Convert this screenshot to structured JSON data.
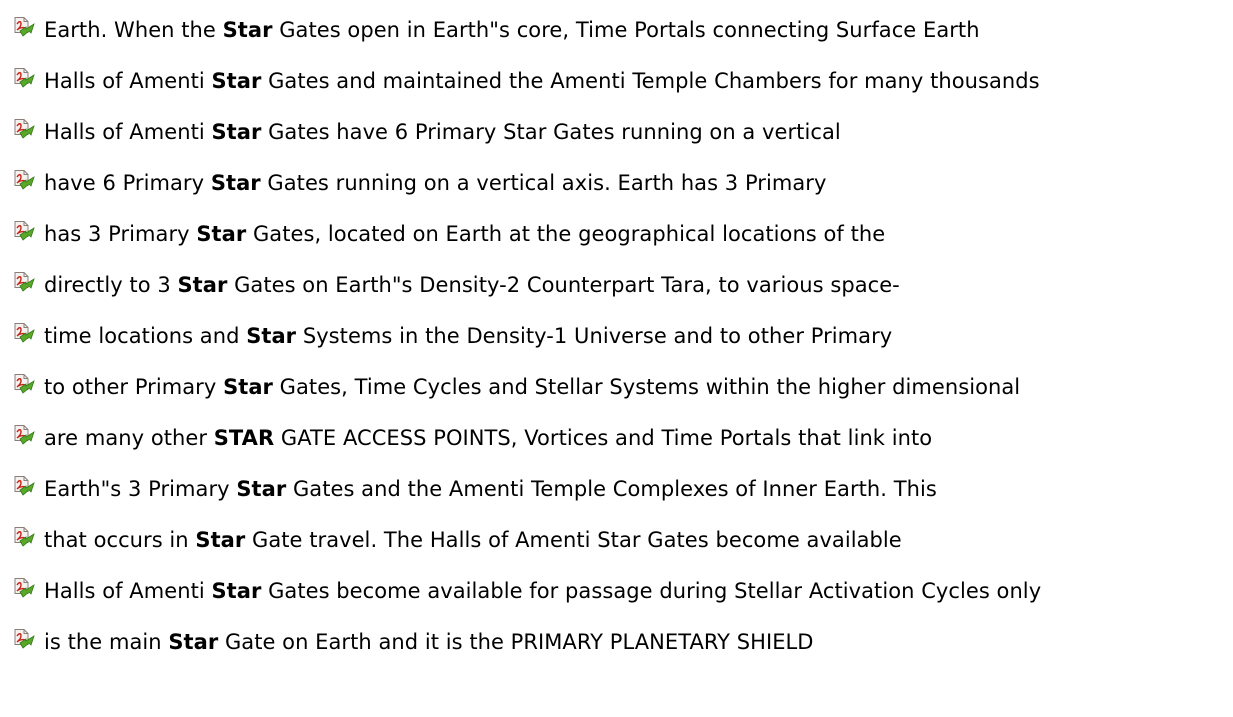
{
  "results": [
    {
      "before": "Earth. When the ",
      "hit": "Star",
      "after": " Gates open in Earth\"s core, Time Portals connecting Surface Earth"
    },
    {
      "before": "Halls of Amenti ",
      "hit": "Star",
      "after": " Gates and maintained the Amenti Temple Chambers for many thousands"
    },
    {
      "before": "Halls of Amenti ",
      "hit": "Star",
      "after": " Gates have 6 Primary Star Gates running on a vertical"
    },
    {
      "before": "have 6 Primary ",
      "hit": "Star",
      "after": " Gates running on a vertical axis. Earth has 3 Primary"
    },
    {
      "before": "has 3 Primary ",
      "hit": "Star",
      "after": " Gates, located on Earth at the geographical locations of the"
    },
    {
      "before": "directly to 3 ",
      "hit": "Star",
      "after": " Gates on Earth\"s Density-2 Counterpart Tara, to various space-"
    },
    {
      "before": "time locations and ",
      "hit": "Star",
      "after": " Systems in the Density-1 Universe and to other Primary"
    },
    {
      "before": "to other Primary ",
      "hit": "Star",
      "after": " Gates, Time Cycles and Stellar Systems within the higher dimensional"
    },
    {
      "before": "are many other ",
      "hit": "STAR",
      "after": " GATE ACCESS POINTS, Vortices and Time Portals that link into"
    },
    {
      "before": "Earth\"s 3 Primary ",
      "hit": "Star",
      "after": " Gates and the Amenti Temple Complexes of Inner Earth. This"
    },
    {
      "before": "that occurs in ",
      "hit": "Star",
      "after": " Gate travel. The Halls of Amenti Star Gates become available"
    },
    {
      "before": "Halls of Amenti ",
      "hit": "Star",
      "after": " Gates become available for passage during Stellar Activation Cycles only"
    },
    {
      "before": "is the main ",
      "hit": "Star",
      "after": " Gate on Earth and it is the PRIMARY PLANETARY SHIELD"
    }
  ],
  "icon": {
    "name": "pdf-document-icon",
    "colors": {
      "page": "#f4f1ee",
      "page_border": "#8a7f78",
      "pdf_red": "#c8241d",
      "arrow_green": "#5aa82a",
      "arrow_dark": "#2f7a14"
    }
  }
}
